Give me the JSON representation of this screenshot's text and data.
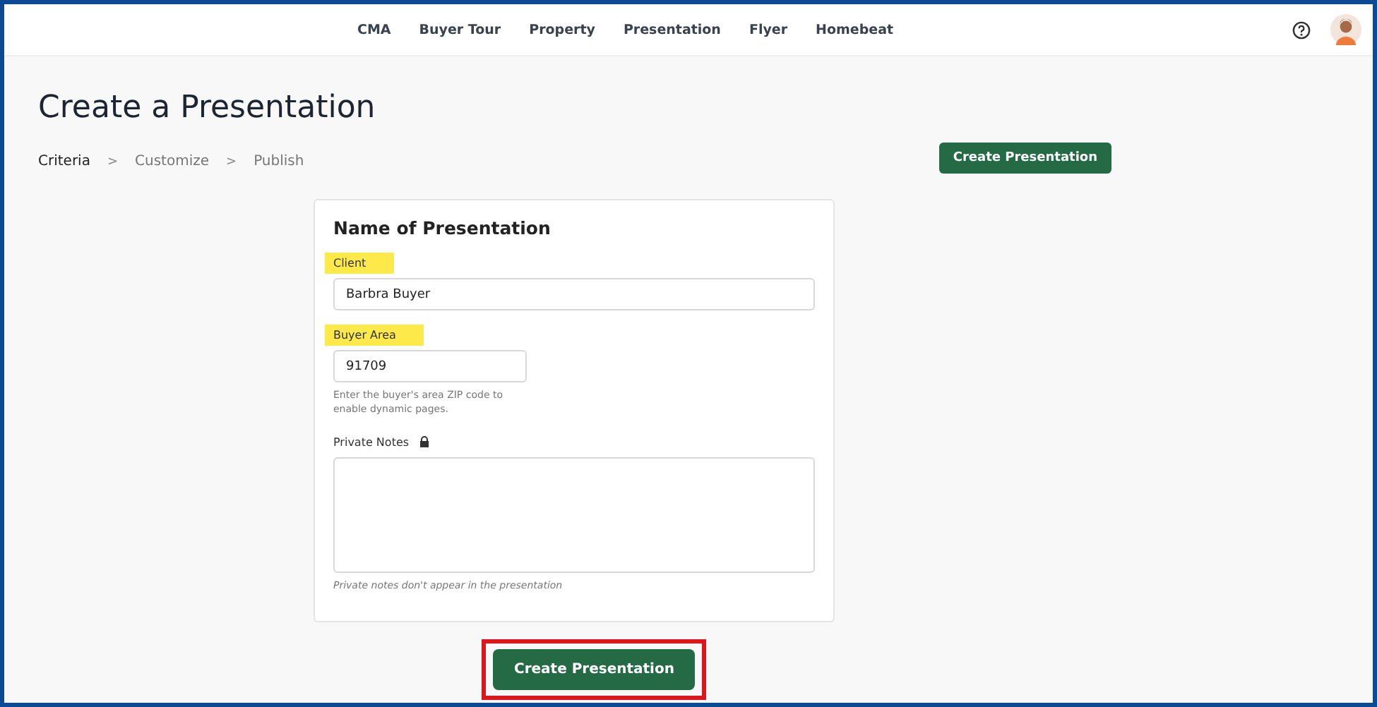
{
  "nav": {
    "items": [
      {
        "label": "CMA",
        "selected": false
      },
      {
        "label": "Buyer Tour",
        "selected": false
      },
      {
        "label": "Property",
        "selected": false
      },
      {
        "label": "Presentation",
        "selected": false
      },
      {
        "label": "Flyer",
        "selected": false
      },
      {
        "label": "Homebeat",
        "selected": false
      }
    ]
  },
  "page": {
    "title": "Create a Presentation",
    "steps": [
      {
        "label": "Criteria",
        "selected": true
      },
      {
        "label": "Customize",
        "selected": false
      },
      {
        "label": "Publish",
        "selected": false
      }
    ],
    "separator": ">",
    "top_button": "Create Presentation"
  },
  "form": {
    "heading": "Name of Presentation",
    "fields": [
      {
        "kind": "input",
        "label": "Client",
        "highlighted": true,
        "value": "Barbra Buyer",
        "wide": true
      },
      {
        "kind": "input",
        "label": "Buyer Area",
        "highlighted": true,
        "value": "91709",
        "wide": false,
        "help": "Enter the buyer's area ZIP code to enable dynamic pages."
      },
      {
        "kind": "textarea",
        "label": "Private Notes",
        "highlighted": false,
        "locked": true,
        "help": "Private notes don't appear in the presentation"
      }
    ]
  },
  "bottom_button": {
    "label": "Create Presentation",
    "annotated": true
  }
}
